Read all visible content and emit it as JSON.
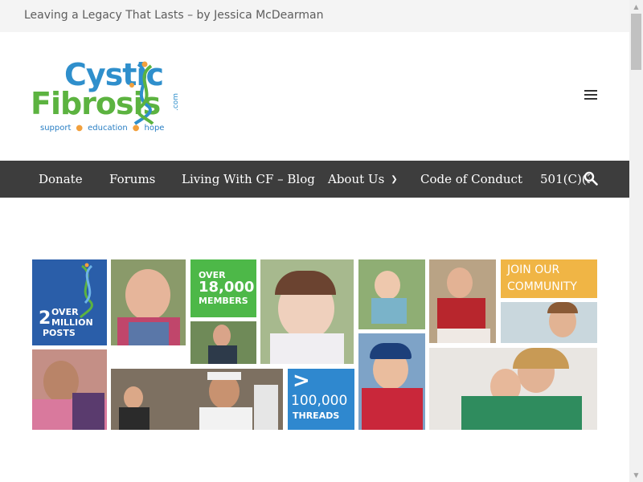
{
  "topbar": {
    "text": "Leaving a Legacy That Lasts – by Jessica McDearman"
  },
  "logo": {
    "line1": "Cystic",
    "line2": "Fibrosis",
    "suffix": ".com",
    "tag1": "support",
    "tag2": "education",
    "tag3": "hope",
    "icon": "dna-helix-icon"
  },
  "nav": {
    "items": [
      {
        "label": "Donate"
      },
      {
        "label": "Forums"
      },
      {
        "label": "Living With CF – Blog"
      },
      {
        "label": "About Us"
      },
      {
        "label": "Code of Conduct"
      },
      {
        "label": "501(C)(3"
      }
    ],
    "icons": {
      "menu": "hamburger-icon",
      "search": "search-icon",
      "dropdown": "chevron-down-icon"
    }
  },
  "collage": {
    "posts": {
      "big": "2",
      "l1": "OVER",
      "l2": "MILLION",
      "l3": "POSTS"
    },
    "members": {
      "l1": "OVER",
      "l2": "18,000",
      "l3": "MEMBERS"
    },
    "threads": {
      "big": "100,000",
      "l2": "THREADS"
    },
    "community": {
      "l1": "JOIN OUR",
      "l2": "COMMUNITY"
    }
  },
  "colors": {
    "nav_bg": "#3d3d3d",
    "topbar_bg": "#f4f4f4",
    "blue_tile": "#2a5ea9",
    "green_tile": "#4db848",
    "orange_tile": "#f0b545",
    "logo_blue": "#2f8fcc",
    "logo_green": "#5cb340"
  }
}
